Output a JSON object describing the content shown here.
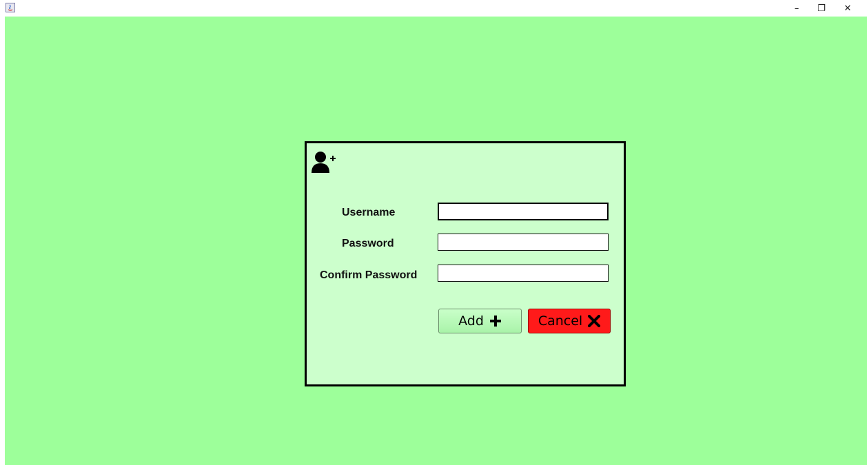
{
  "window": {
    "app_icon": "java-app-icon",
    "minimize_glyph": "–",
    "maximize_glyph": "❐",
    "close_glyph": "✕"
  },
  "colors": {
    "background": "#9dff9a",
    "panel": "#ccffcc",
    "add_button": "#b4f5b4",
    "cancel_button": "#ff1a1a"
  },
  "form": {
    "header_icon": "user-plus-icon",
    "fields": {
      "username": {
        "label": "Username",
        "value": ""
      },
      "password": {
        "label": "Password",
        "value": ""
      },
      "confirm_password": {
        "label": "Confirm Password",
        "value": ""
      }
    },
    "buttons": {
      "add": {
        "label": "Add",
        "icon": "plus-icon"
      },
      "cancel": {
        "label": "Cancel",
        "icon": "x-icon"
      }
    }
  }
}
